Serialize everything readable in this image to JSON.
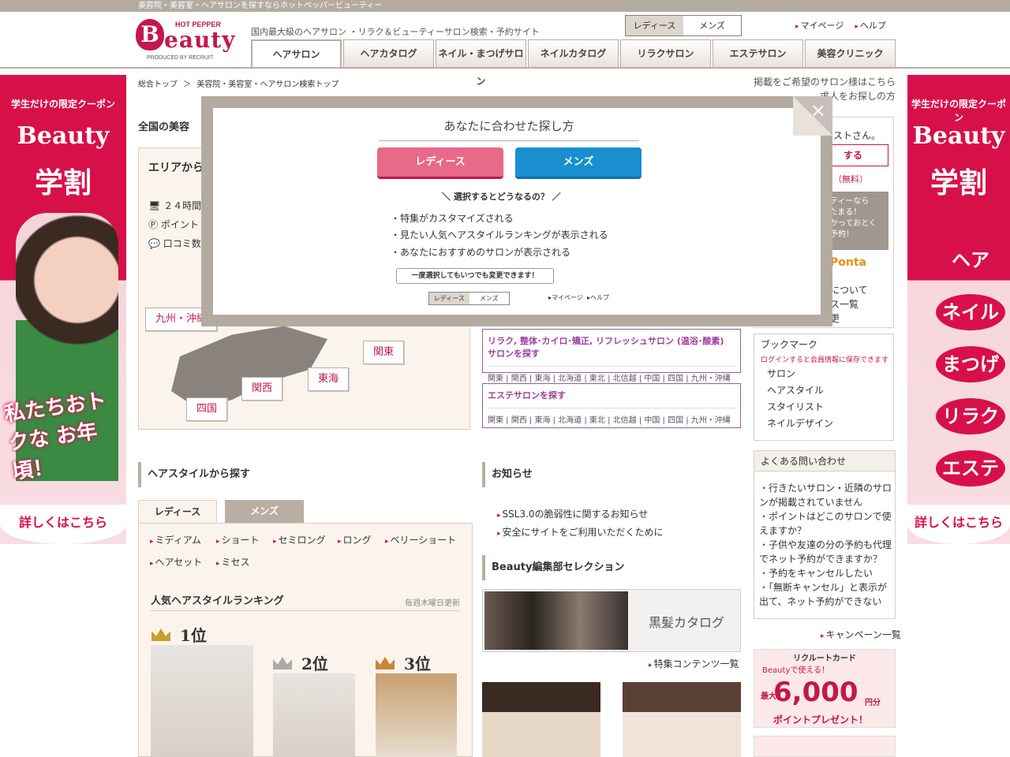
{
  "topbar": "美容院・美容室・ヘアサロンを探すならホットペッパービューティー",
  "logo": {
    "hp": "HOT PEPPER",
    "b": "B",
    "eauty": "eauty",
    "produced": "PRODUCED BY RECRUIT"
  },
  "tagline": "国内最大級のヘアサロン ・リラク＆ビューティーサロン検索・予約サイト",
  "gender": {
    "ladies": "レディース",
    "mens": "メンズ"
  },
  "toplinks": [
    "マイページ",
    "ヘルプ"
  ],
  "nav": [
    "ヘアサロン",
    "ヘアカタログ",
    "ネイル・まつげサロン",
    "ネイルカタログ",
    "リラクサロン",
    "エステサロン",
    "美容クリニック"
  ],
  "banner": {
    "t1": "学生だけの限定クーポン",
    "t2": "Beauty",
    "t3": "学割",
    "slogan": "私たちおトクな お年頃！",
    "more": "詳しくはこちら",
    "circles": [
      "ヘア",
      "ネイル",
      "まつげ",
      "リラク",
      "エステ"
    ]
  },
  "breadcrumb": [
    "総合トップ",
    "＞",
    "美容院・美容室・ヘアサロン検索トップ"
  ],
  "rightlinks": [
    "掲載をご希望のサロン様はこちら",
    "求人をお探しの方"
  ],
  "main": {
    "title": "全国の美容",
    "area_title": "エリアから",
    "features": [
      "２４時間",
      "ポイント",
      "口コミ数"
    ],
    "regions": [
      "九州・沖縄",
      "関東",
      "東海",
      "関西",
      "四国"
    ]
  },
  "relax": {
    "title": "リラク, 整体･カイロ･矯正, リフレッシュサロン (温浴･酸素) サロンを探す",
    "links": "関東 | 関西 | 東海 | 北海道 | 東北 | 北信越 | 中国 | 四国 | 九州・沖縄"
  },
  "esthe": {
    "title": "エステサロンを探す",
    "links": "関東 | 関西 | 東海 | 北海道 | 東北 | 北信越 | 中国 | 四国 | 九州・沖縄"
  },
  "side": {
    "guest": "ストさん。",
    "reg": "する",
    "free": "（無料）",
    "promo1": "ーティーなら",
    "promo2": "%たまる！",
    "promo3": "つかっておとく",
    "promo4": "ト予約！",
    "ponta": "Ponta",
    "l1": "について",
    "l2": "ス一覧",
    "l3": "更"
  },
  "bookmark": {
    "title": "ブックマーク",
    "note": "ログインすると会員情報に保存できます",
    "items": [
      "サロン",
      "ヘアスタイル",
      "スタイリスト",
      "ネイルデザイン"
    ]
  },
  "hairstyle": {
    "title": "ヘアスタイルから探す",
    "tabs": [
      "レディース",
      "メンズ"
    ],
    "cats": [
      "ミディアム",
      "ショート",
      "セミロング",
      "ロング",
      "ベリーショート",
      "ヘアセット",
      "ミセス"
    ],
    "ranking": "人気ヘアスタイルランキング",
    "update": "毎週木曜日更新",
    "ranks": [
      "1位",
      "2位",
      "3位"
    ]
  },
  "news": {
    "title": "お知らせ",
    "items": [
      "SSL3.0の脆弱性に関するお知らせ",
      "安全にサイトをご利用いただくために"
    ]
  },
  "editor": {
    "title": "Beauty編集部セレクション",
    "kuro": "黒髪カタログ",
    "more": "特集コンテンツ一覧"
  },
  "faq": {
    "title": "よくある問い合わせ",
    "items": [
      "行きたいサロン・近隣のサロンが掲載されていません",
      "ポイントはどこのサロンで使えますか？",
      "子供や友達の分の予約も代理でネット予約ができますか？",
      "予約をキャンセルしたい",
      "「無断キャンセル」と表示が出て、ネット予約ができない"
    ]
  },
  "campaign": "キャンペーン一覧",
  "card": {
    "title": "リクルートカード",
    "use": "Beautyで使える！",
    "amount": "6,000",
    "unit": "円分",
    "present": "ポイントプレゼント！",
    "max": "最大"
  },
  "modal": {
    "title": "あなたに合わせた探し方",
    "ladies": "レディース",
    "mens": "メンズ",
    "question": "選択するとどうなるの？",
    "bullets": [
      "・特集がカスタマイズされる",
      "・見たい人気ヘアスタイルランキングが表示される",
      "・あなたにおすすめのサロンが表示される"
    ],
    "note": "一度選択してもいつでも変更できます！",
    "mini_l": "レディース",
    "mini_m": "メンズ",
    "mypage": "マイページ",
    "help": "ヘルプ",
    "close": "×"
  },
  "colors": {
    "brand": "#c4174b",
    "ladies": "#e86a88",
    "mens": "#1a8fd0",
    "frame": "#b4aba0"
  }
}
